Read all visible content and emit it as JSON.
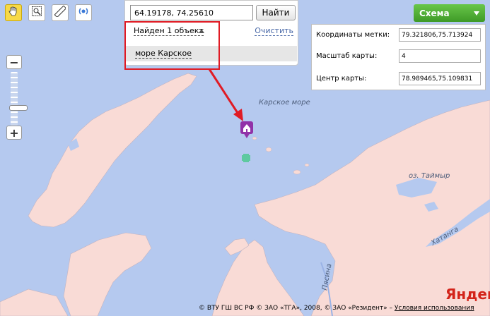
{
  "toolbar": {
    "tools": [
      {
        "icon": "hand-icon",
        "active": true
      },
      {
        "icon": "zoom-rectangle-icon",
        "active": false
      },
      {
        "icon": "ruler-icon",
        "active": false
      },
      {
        "icon": "traffic-signal-icon",
        "active": false
      }
    ]
  },
  "search": {
    "value": "64.19178, 74.25610",
    "button_label": "Найти",
    "found_label": "Найден 1 объект",
    "clear_label": "Очистить",
    "result": "море Карское"
  },
  "map_type": {
    "label": "Схема"
  },
  "info": {
    "rows": [
      {
        "label": "Координаты метки:",
        "value": "79.321806,75.713924"
      },
      {
        "label": "Масштаб карты:",
        "value": "4"
      },
      {
        "label": "Центр карты:",
        "value": "78.989465,75.109831"
      }
    ]
  },
  "map_labels": {
    "sea": "Карское море",
    "lake": "оз. Таймыр",
    "river1": "Хатанга",
    "river2": "Пясина"
  },
  "footer": {
    "brand": "Яндекс",
    "copyright": "© ВТУ ГШ ВС РФ © ЗАО «ТГА», 2008, © ЗАО «Резидент» – ",
    "terms": "Условия использования"
  },
  "colors": {
    "sea": "#b5c9ef",
    "land": "#f9dbd6",
    "accent": "#e01b24",
    "schema_button": "#4aa52f"
  }
}
